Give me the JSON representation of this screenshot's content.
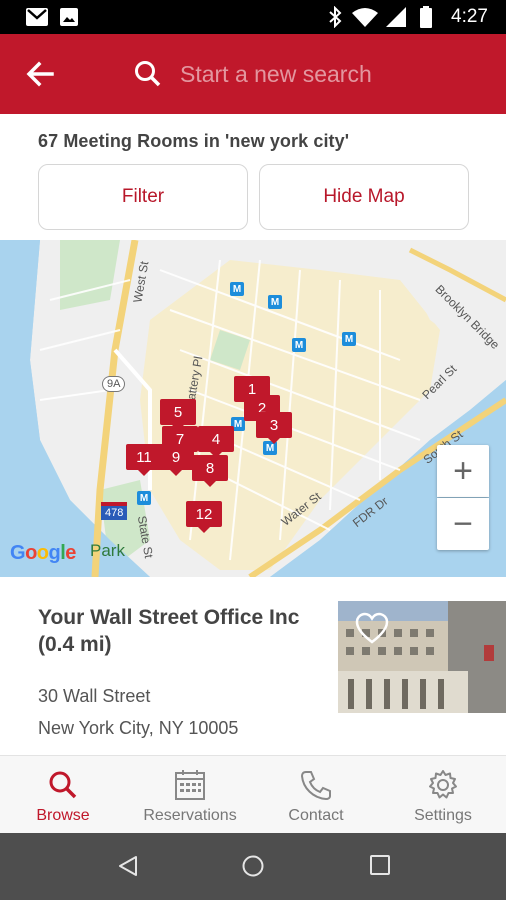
{
  "status_bar": {
    "time": "4:27"
  },
  "header": {
    "search_placeholder": "Start a new search"
  },
  "results": {
    "count_text": "67 Meeting Rooms in 'new york city'"
  },
  "actions": {
    "filter_label": "Filter",
    "hide_map_label": "Hide Map"
  },
  "map": {
    "pins": [
      "1",
      "2",
      "3",
      "4",
      "5",
      "7",
      "8",
      "9",
      "11",
      "12"
    ],
    "streets": [
      "West St",
      "Battery Pl",
      "State St",
      "Water St",
      "Pearl St",
      "South St",
      "FDR Dr",
      "Brooklyn Bridge"
    ],
    "highway_shields": [
      "9A",
      "478"
    ],
    "zoom_in": "+",
    "zoom_out": "−",
    "logo_text": "Google",
    "park_label": "Park"
  },
  "listing": {
    "name": "Your Wall Street Office Inc (0.4 mi)",
    "address_line1": "30 Wall Street",
    "address_line2": "New York City, NY 10005"
  },
  "bottom_nav": {
    "browse": "Browse",
    "reservations": "Reservations",
    "contact": "Contact",
    "settings": "Settings"
  },
  "colors": {
    "brand": "#c0182b",
    "map_water": "#a9d3ee",
    "map_land": "#f5efd9"
  }
}
